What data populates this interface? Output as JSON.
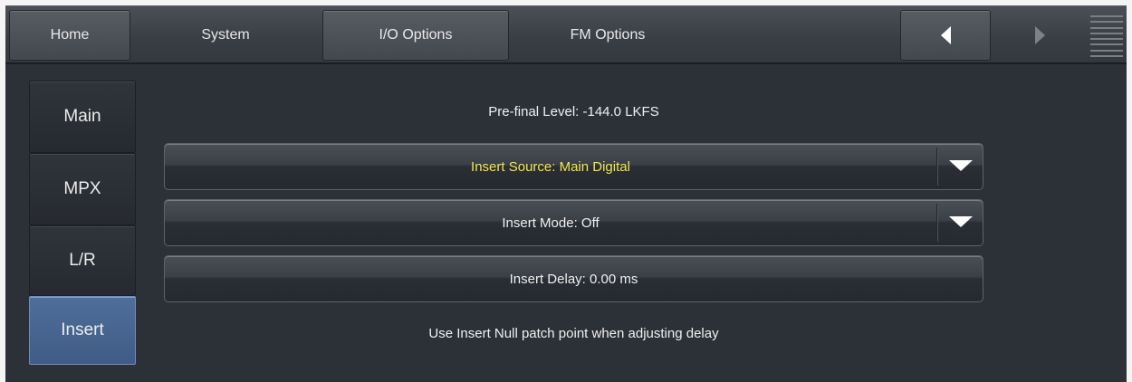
{
  "topnav": {
    "tabs": [
      "Home",
      "System",
      "I/O Options",
      "FM Options"
    ],
    "prev_icon": "triangle-left-icon",
    "next_icon": "triangle-right-icon",
    "menu_icon": "hamburger-menu-icon"
  },
  "sidebar": {
    "items": [
      {
        "label": "Main"
      },
      {
        "label": "MPX"
      },
      {
        "label": "L/R"
      },
      {
        "label": "Insert"
      }
    ],
    "active": "Insert"
  },
  "main": {
    "prefinal_level": "Pre-final Level: -144.0 LKFS",
    "insert_source": "Insert Source: Main Digital",
    "insert_mode": "Insert Mode: Off",
    "insert_delay": "Insert Delay: 0.00 ms",
    "hint": "Use Insert Null patch point when adjusting delay"
  },
  "colors": {
    "background": "#2c3138",
    "active_tab": "#4a6891",
    "highlight_text": "#f4e84a"
  }
}
